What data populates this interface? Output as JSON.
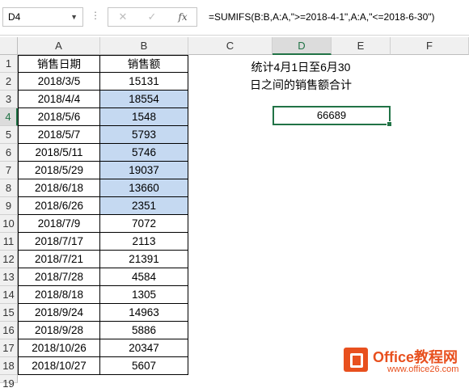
{
  "formula_bar": {
    "name_box": "D4",
    "cancel_glyph": "✕",
    "enter_glyph": "✓",
    "fx_glyph": "fx",
    "formula": "=SUMIFS(B:B,A:A,\">=2018-4-1\",A:A,\"<=2018-6-30\")"
  },
  "columns": [
    "A",
    "B",
    "C",
    "D",
    "E",
    "F"
  ],
  "selected_column": "D",
  "selected_row": 4,
  "rows": [
    "1",
    "2",
    "3",
    "4",
    "5",
    "6",
    "7",
    "8",
    "9",
    "10",
    "11",
    "12",
    "13",
    "14",
    "15",
    "16",
    "17",
    "18",
    "19"
  ],
  "table": {
    "header": [
      "销售日期",
      "销售额"
    ],
    "rows": [
      [
        "2018/3/5",
        "15131"
      ],
      [
        "2018/4/4",
        "18554"
      ],
      [
        "2018/5/6",
        "1548"
      ],
      [
        "2018/5/7",
        "5793"
      ],
      [
        "2018/5/11",
        "5746"
      ],
      [
        "2018/5/29",
        "19037"
      ],
      [
        "2018/6/18",
        "13660"
      ],
      [
        "2018/6/26",
        "2351"
      ],
      [
        "2018/7/9",
        "7072"
      ],
      [
        "2018/7/17",
        "2113"
      ],
      [
        "2018/7/21",
        "21391"
      ],
      [
        "2018/7/28",
        "4584"
      ],
      [
        "2018/8/18",
        "1305"
      ],
      [
        "2018/9/24",
        "14963"
      ],
      [
        "2018/9/28",
        "5886"
      ],
      [
        "2018/10/26",
        "20347"
      ],
      [
        "2018/10/27",
        "5607"
      ]
    ],
    "highlighted_rows": [
      2,
      3,
      4,
      5,
      6,
      7,
      8
    ],
    "highlight_color": "#c5d9f1"
  },
  "note": {
    "line1": "统计4月1日至6月30",
    "line2": "日之间的销售额合计"
  },
  "result": "66689",
  "accent_color": "#217346",
  "watermark": {
    "text": "Office教程网",
    "url": "www.office26.com"
  }
}
